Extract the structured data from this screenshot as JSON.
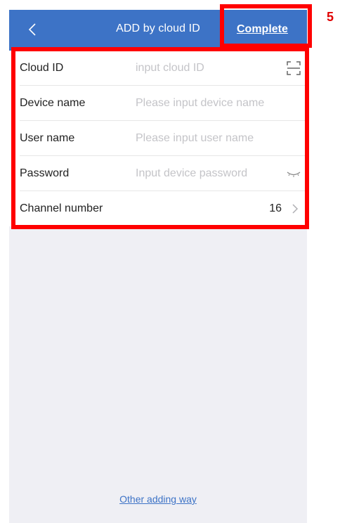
{
  "header": {
    "title": "ADD by cloud ID",
    "complete_label": "Complete"
  },
  "form": {
    "cloud_id": {
      "label": "Cloud ID",
      "placeholder": "input cloud ID",
      "value": ""
    },
    "device_name": {
      "label": "Device name",
      "placeholder": "Please input device name",
      "value": ""
    },
    "user_name": {
      "label": "User name",
      "placeholder": "Please input user name",
      "value": ""
    },
    "password": {
      "label": "Password",
      "placeholder": "Input device password",
      "value": ""
    },
    "channel_number": {
      "label": "Channel number",
      "value": "16"
    }
  },
  "footer": {
    "other_adding_way": "Other adding way"
  },
  "annotation": {
    "step_number": "5",
    "highlight_color": "#ff0000"
  },
  "colors": {
    "nav_bar": "#3d73c6",
    "background": "#efeff4",
    "link": "#3d73c6"
  },
  "icons": [
    "back-arrow-icon",
    "scan-icon",
    "eye-closed-icon",
    "chevron-right-icon"
  ]
}
